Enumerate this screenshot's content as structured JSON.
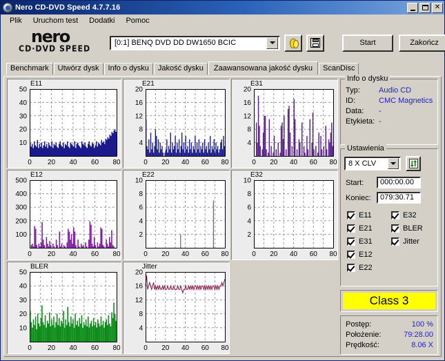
{
  "window": {
    "title": "Nero CD-DVD Speed 4.7.7.16",
    "icon": "nero-disc-icon",
    "minimize_label": "_",
    "maximize_label": "□",
    "close_label": "✕"
  },
  "menu": {
    "items": [
      {
        "label": "Plik"
      },
      {
        "label": "Uruchom test"
      },
      {
        "label": "Dodatki"
      },
      {
        "label": "Pomoc"
      }
    ]
  },
  "logo": {
    "line1": "nero",
    "line2": "CD·DVD SPEED"
  },
  "toolbar": {
    "drive_value": "[0:1]   BENQ DVD DD DW1650 BCIC",
    "burn_icon": "flame-icon",
    "save_icon": "floppy-disk-icon",
    "start_label": "Start",
    "quit_label": "Zakończ"
  },
  "tabs": [
    {
      "label": "Benchmark",
      "active": false
    },
    {
      "label": "Utwórz dysk",
      "active": false
    },
    {
      "label": "Info o dysku",
      "active": false
    },
    {
      "label": "Jakość dysku",
      "active": false
    },
    {
      "label": "Zaawansowana jakość dysku",
      "active": true
    },
    {
      "label": "ScanDisc",
      "active": false
    }
  ],
  "disc_info": {
    "title": "Info o dysku",
    "rows": [
      {
        "key": "Typ:",
        "value": "Audio CD"
      },
      {
        "key": "ID:",
        "value": "CMC Magnetics"
      },
      {
        "key": "Data:",
        "value": "-"
      },
      {
        "key": "Etykieta:",
        "value": "-"
      }
    ]
  },
  "settings": {
    "title": "Ustawienia",
    "speed_value": "8 X CLV",
    "refresh_icon": "refresh-arrows-icon",
    "start_label": "Start:",
    "start_value": "000:00.00",
    "end_label": "Koniec:",
    "end_value": "079:30.71",
    "checkboxes_left": [
      {
        "label": "E11",
        "checked": true
      },
      {
        "label": "E21",
        "checked": true
      },
      {
        "label": "E31",
        "checked": true
      },
      {
        "label": "E12",
        "checked": true
      },
      {
        "label": "E22",
        "checked": true
      }
    ],
    "checkboxes_right": [
      {
        "label": "E32",
        "checked": true
      },
      {
        "label": "BLER",
        "checked": true
      },
      {
        "label": "Jitter",
        "checked": true
      }
    ]
  },
  "class_badge": {
    "label": "Class 3",
    "color": "#ffff00"
  },
  "status": {
    "rows": [
      {
        "key": "Postęp:",
        "value": "100 %"
      },
      {
        "key": "Położenie:",
        "value": "79:28.00"
      },
      {
        "key": "Prędkość:",
        "value": "8.06 X"
      }
    ]
  },
  "colors": {
    "navy": "#1a1a8c",
    "purple": "#7d1f9e",
    "green": "#0a8a16",
    "maroon": "#8c1040",
    "title_gradient_start": "#0a246a",
    "accent_text": "#2222cc"
  },
  "chart_data": [
    {
      "type": "area",
      "title": "E11",
      "xlabel": "",
      "ylabel": "",
      "xlim": [
        0,
        80
      ],
      "ylim": [
        0,
        50
      ],
      "xticks": [
        0,
        20,
        40,
        60,
        80
      ],
      "yticks": [
        10,
        20,
        30,
        40,
        50
      ],
      "grid": true,
      "color": "#1a1a8c",
      "note": "Dense noisy band averaging ~8-10, rising to ~18-20 near the end of the disc",
      "values": [
        10,
        7,
        9,
        6,
        11,
        8,
        7,
        12,
        6,
        9,
        7,
        10,
        6,
        8,
        11,
        7,
        9,
        6,
        10,
        8,
        7,
        11,
        6,
        9,
        8,
        10,
        7,
        6,
        9,
        11,
        8,
        7,
        10,
        6,
        9,
        8,
        11,
        7,
        6,
        10,
        9,
        8,
        7,
        11,
        6,
        9,
        10,
        8,
        7,
        6,
        11,
        9,
        8,
        10,
        7,
        6,
        9,
        11,
        8,
        7,
        10,
        9,
        6,
        8,
        11,
        7,
        10,
        9,
        8,
        12,
        10,
        11,
        9,
        13,
        12,
        14,
        13,
        16,
        15,
        18,
        17,
        19,
        20,
        18
      ]
    },
    {
      "type": "area",
      "title": "E21",
      "xlabel": "",
      "ylabel": "",
      "xlim": [
        0,
        80
      ],
      "ylim": [
        0,
        20
      ],
      "xticks": [
        0,
        20,
        40,
        60,
        80
      ],
      "yticks": [
        4,
        8,
        12,
        16,
        20
      ],
      "grid": true,
      "color": "#1a1a8c",
      "note": "Spiky values mostly 1-5 with occasional peaks to 8-11",
      "values": [
        11,
        3,
        2,
        5,
        1,
        7,
        2,
        4,
        1,
        3,
        8,
        6,
        2,
        5,
        1,
        4,
        2,
        3,
        1,
        0,
        1,
        2,
        5,
        1,
        3,
        2,
        7,
        1,
        4,
        2,
        3,
        6,
        1,
        4,
        2,
        5,
        1,
        3,
        7,
        2,
        4,
        1,
        6,
        2,
        3,
        1,
        5,
        2,
        4,
        1,
        3,
        2,
        6,
        1,
        4,
        2,
        5,
        1,
        3,
        2,
        4,
        1,
        5,
        2,
        3,
        1,
        4,
        2,
        6,
        1,
        3,
        2,
        5,
        1,
        4,
        2,
        3,
        1,
        2,
        4,
        5,
        2,
        6,
        3
      ]
    },
    {
      "type": "bar",
      "title": "E31",
      "xlabel": "",
      "ylabel": "",
      "xlim": [
        0,
        80
      ],
      "ylim": [
        0,
        20
      ],
      "xticks": [
        0,
        20,
        40,
        60,
        80
      ],
      "yticks": [
        4,
        8,
        12,
        16,
        20
      ],
      "grid": true,
      "color": "#5a1f8c",
      "note": "Sparse tall spikes reaching up to 18",
      "values": [
        0,
        0,
        10,
        4,
        18,
        9,
        3,
        0,
        2,
        7,
        12,
        12,
        2,
        0,
        1,
        11,
        0,
        3,
        0,
        1,
        6,
        0,
        2,
        0,
        4,
        0,
        1,
        9,
        10,
        5,
        12,
        0,
        2,
        0,
        14,
        15,
        7,
        0,
        3,
        0,
        17,
        11,
        0,
        2,
        0,
        5,
        4,
        0,
        10,
        0,
        3,
        1,
        0,
        6,
        2,
        0,
        11,
        0,
        4,
        13,
        2,
        0,
        3,
        0,
        1,
        7,
        0,
        6,
        2,
        0,
        3,
        0,
        9,
        2,
        0,
        5,
        4,
        7,
        10,
        3
      ]
    },
    {
      "type": "bar",
      "title": "E12",
      "xlabel": "",
      "ylabel": "",
      "xlim": [
        0,
        80
      ],
      "ylim": [
        0,
        500
      ],
      "xticks": [
        0,
        20,
        40,
        60,
        80
      ],
      "yticks": [
        100,
        200,
        300,
        400,
        500
      ],
      "grid": true,
      "color": "#7d1f9e",
      "note": "Sparse spikes mostly under 200",
      "values": [
        0,
        20,
        30,
        10,
        160,
        140,
        20,
        0,
        30,
        10,
        40,
        190,
        60,
        20,
        0,
        80,
        30,
        10,
        50,
        20,
        0,
        30,
        10,
        0,
        60,
        20,
        0,
        120,
        10,
        30,
        0,
        20,
        10,
        0,
        40,
        140,
        120,
        60,
        100,
        30,
        150,
        120,
        20,
        0,
        60,
        10,
        0,
        30,
        10,
        20,
        0,
        40,
        10,
        0,
        60,
        195,
        170,
        30,
        10,
        80,
        20,
        0,
        40,
        10,
        30,
        150,
        140,
        20,
        10,
        0,
        60,
        30,
        10,
        80,
        40,
        130,
        20,
        10,
        0,
        0
      ]
    },
    {
      "type": "bar",
      "title": "E22",
      "xlabel": "",
      "ylabel": "",
      "xlim": [
        0,
        80
      ],
      "ylim": [
        0,
        10
      ],
      "xticks": [
        0,
        20,
        40,
        60,
        80
      ],
      "yticks": [
        2,
        4,
        6,
        8,
        10
      ],
      "grid": true,
      "color": "#7d1f9e",
      "note": "Only two events: ~2 near x=35 and ~7 near x=68",
      "points": [
        {
          "x": 35,
          "y": 2
        },
        {
          "x": 68,
          "y": 7
        }
      ]
    },
    {
      "type": "bar",
      "title": "E32",
      "xlabel": "",
      "ylabel": "",
      "xlim": [
        0,
        80
      ],
      "ylim": [
        0,
        10
      ],
      "xticks": [
        0,
        20,
        40,
        60,
        80
      ],
      "yticks": [
        2,
        4,
        6,
        8,
        10
      ],
      "grid": true,
      "color": "#7d1f9e",
      "note": "No data points — empty plot",
      "points": []
    },
    {
      "type": "area",
      "title": "BLER",
      "xlabel": "",
      "ylabel": "",
      "xlim": [
        0,
        80
      ],
      "ylim": [
        0,
        50
      ],
      "xticks": [
        0,
        20,
        40,
        60,
        80
      ],
      "yticks": [
        10,
        20,
        30,
        40,
        50
      ],
      "grid": true,
      "color": "#0a8a16",
      "note": "Dense green band averaging ~12-15 with spikes to ~26-28",
      "values": [
        22,
        14,
        10,
        16,
        12,
        18,
        9,
        20,
        13,
        11,
        17,
        26,
        14,
        12,
        19,
        10,
        15,
        13,
        21,
        11,
        16,
        12,
        18,
        10,
        14,
        20,
        12,
        17,
        11,
        15,
        13,
        22,
        10,
        16,
        12,
        25,
        14,
        11,
        18,
        13,
        16,
        10,
        20,
        12,
        15,
        11,
        17,
        13,
        19,
        10,
        14,
        12,
        16,
        11,
        18,
        10,
        13,
        15,
        11,
        17,
        12,
        14,
        10,
        16,
        13,
        11,
        18,
        12,
        15,
        10,
        14,
        16,
        12,
        19,
        13,
        11,
        21,
        17,
        28,
        20,
        15
      ]
    },
    {
      "type": "line",
      "title": "Jitter",
      "xlabel": "",
      "ylabel": "",
      "xlim": [
        0,
        80
      ],
      "ylim": [
        0,
        20
      ],
      "xticks": [
        0,
        20,
        40,
        60,
        80
      ],
      "yticks": [
        4,
        8,
        12,
        16,
        20
      ],
      "grid": true,
      "color": "#8c1040",
      "note": "Noisy trace hovering near 15-16 across the whole disc",
      "values": [
        16,
        19,
        15,
        16,
        17,
        16,
        15,
        16,
        17,
        15,
        16,
        15,
        16,
        15,
        16,
        15,
        15,
        16,
        15,
        16,
        15,
        15,
        16,
        15,
        15,
        16,
        15,
        15,
        16,
        15,
        15,
        15,
        16,
        15,
        15,
        16,
        15,
        14,
        15,
        15,
        16,
        15,
        15,
        16,
        15,
        16,
        15,
        16,
        15,
        16,
        16,
        15,
        16,
        15,
        16,
        15,
        16,
        16,
        15,
        16,
        15,
        16,
        15,
        16,
        15,
        16,
        15,
        16,
        16,
        15,
        16,
        15,
        16,
        15,
        16,
        16,
        17,
        16,
        17,
        18
      ]
    }
  ]
}
